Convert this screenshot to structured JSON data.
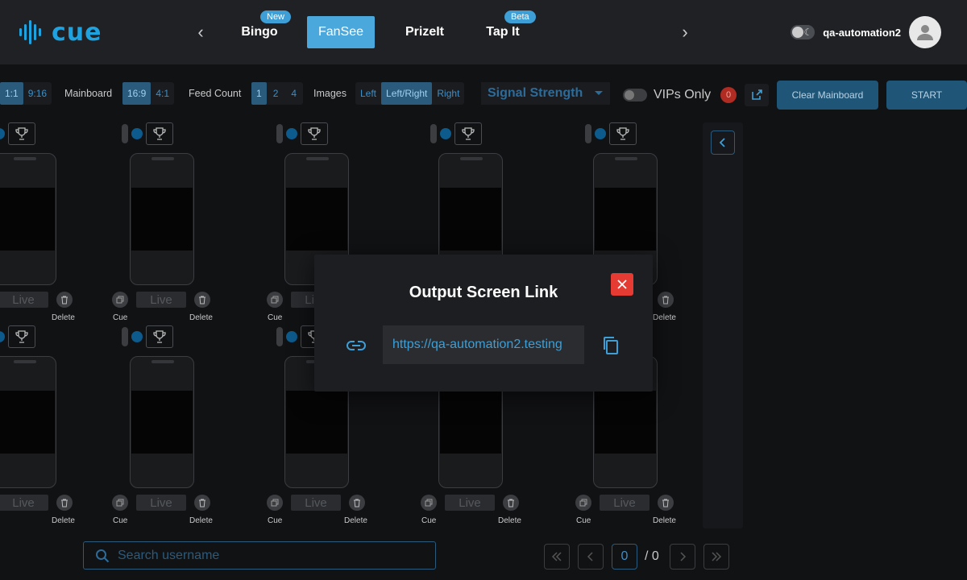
{
  "header": {
    "logo": "cue",
    "tabs": [
      {
        "label": "Bingo",
        "badge": "New"
      },
      {
        "label": "FanSee",
        "badge": ""
      },
      {
        "label": "PrizeIt",
        "badge": ""
      },
      {
        "label": "Tap It",
        "badge": "Beta"
      }
    ],
    "active_tab": "FanSee",
    "username": "qa-automation2"
  },
  "toolbar": {
    "aspect_options": [
      "1:1",
      "9:16"
    ],
    "mainboard_label": "Mainboard",
    "mainboard_options": [
      "16:9",
      "4:1"
    ],
    "mainboard_selected": "16:9",
    "feed_count_label": "Feed Count",
    "feed_count_options": [
      "1",
      "2",
      "4"
    ],
    "feed_count_selected": "1",
    "images_label": "Images",
    "images_options": [
      "Left",
      "Left/Right",
      "Right"
    ],
    "images_selected": "Left/Right",
    "sort_value": "Signal Strength",
    "vips_label": "VIPs Only",
    "vip_count": "0",
    "clear_label": "Clear Mainboard",
    "start_label": "START"
  },
  "feed_cell": {
    "live_label": "Live",
    "cue_label": "Cue",
    "delete_label": "Delete"
  },
  "search": {
    "placeholder": "Search username"
  },
  "pagination": {
    "current": "0",
    "total": "/ 0"
  },
  "modal": {
    "title": "Output Screen Link",
    "url": "https://qa-automation2.testing"
  },
  "colors": {
    "accent": "#1ea3e0",
    "active_tab": "#4aa8dc",
    "button": "#1f5577",
    "close": "#e53b33",
    "badge": "#3d9fd6"
  }
}
